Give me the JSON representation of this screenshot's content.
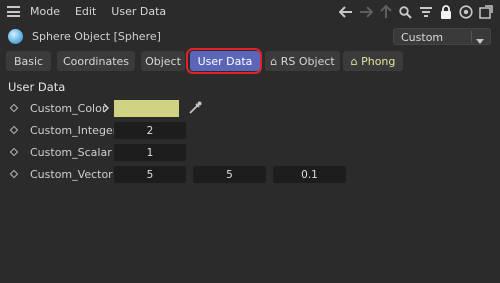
{
  "menu": {
    "mode": "Mode",
    "edit": "Edit",
    "user_data": "User Data"
  },
  "object": {
    "title": "Sphere Object [Sphere]",
    "preset": "Custom"
  },
  "tabs": [
    "Basic",
    "Coordinates",
    "Object",
    "User Data",
    "⌂ RS Object",
    "⌂ Phong"
  ],
  "section_title": "User Data",
  "params": {
    "color": {
      "label": "Custom_Color",
      "value": "#cfd183"
    },
    "integer": {
      "label": "Custom_Integer",
      "value": "2"
    },
    "scalar": {
      "label": "Custom_Scalar",
      "value": "1"
    },
    "vector": {
      "label": "Custom_Vector",
      "x": "5",
      "y": "5",
      "z": "0.1"
    }
  },
  "colors": {
    "active_tab": "#5b66b8",
    "highlight": "#e2222a",
    "phong_tab_text": "#e5e59a"
  },
  "icons": [
    "menu-icon",
    "back-arrow-icon",
    "forward-arrow-icon",
    "up-arrow-icon",
    "search-icon",
    "filter-icon",
    "lock-icon",
    "target-icon",
    "new-window-icon",
    "chevron-down-icon",
    "expand-chevron-icon",
    "eyedropper-icon",
    "sphere-icon"
  ]
}
